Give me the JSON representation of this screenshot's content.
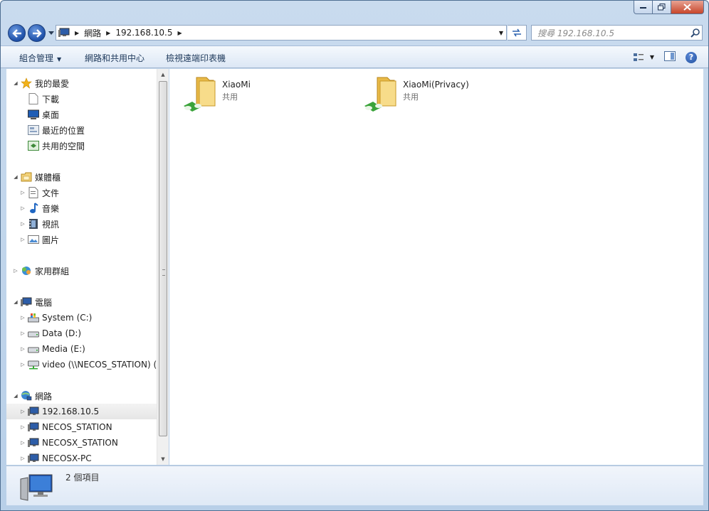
{
  "window": {
    "caption": {
      "minimize": "minimize",
      "maximize": "maximize",
      "close": "close"
    }
  },
  "nav": {
    "breadcrumb": [
      "網路",
      "192.168.10.5"
    ],
    "search_placeholder": "搜尋 192.168.10.5"
  },
  "toolbar": {
    "organize": "組合管理",
    "network_sharing": "網路和共用中心",
    "view_printers": "檢視遠端印表機"
  },
  "sidebar": {
    "favorites": {
      "label": "我的最愛",
      "items": [
        "下載",
        "桌面",
        "最近的位置",
        "共用的空間"
      ]
    },
    "libraries": {
      "label": "媒體櫃",
      "items": [
        "文件",
        "音樂",
        "視訊",
        "圖片"
      ]
    },
    "homegroup": {
      "label": "家用群組"
    },
    "computer": {
      "label": "電腦",
      "items": [
        "System (C:)",
        "Data (D:)",
        "Media (E:)",
        "video (\\\\NECOS_STATION) ("
      ]
    },
    "network": {
      "label": "網路",
      "items": [
        "192.168.10.5",
        "NECOS_STATION",
        "NECOSX_STATION",
        "NECOSX-PC"
      ]
    }
  },
  "main": {
    "items": [
      {
        "name": "XiaoMi",
        "type": "共用"
      },
      {
        "name": "XiaoMi(Privacy)",
        "type": "共用"
      }
    ]
  },
  "details": {
    "count": "2 個項目"
  },
  "colors": {
    "accent": "#1d4fa8",
    "folder": "#f2cf6a",
    "share": "#3aa33a"
  }
}
